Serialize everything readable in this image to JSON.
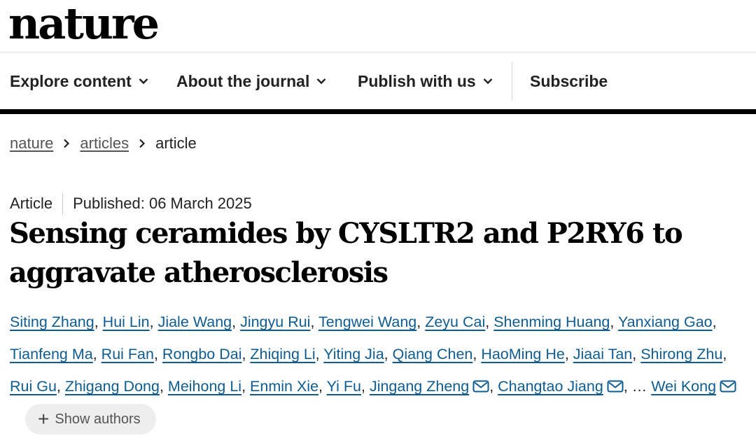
{
  "header": {
    "logo": "nature"
  },
  "nav": {
    "items": [
      {
        "label": "Explore content"
      },
      {
        "label": "About the journal"
      },
      {
        "label": "Publish with us"
      }
    ],
    "subscribe": "Subscribe"
  },
  "breadcrumb": {
    "items": [
      "nature",
      "articles",
      "article"
    ]
  },
  "article": {
    "type": "Article",
    "published": "Published: 06 March 2025",
    "title": "Sensing ceramides by CYSLTR2 and P2RY6 to aggravate atherosclerosis"
  },
  "authors": {
    "list": [
      "Siting Zhang",
      "Hui Lin",
      "Jiale Wang",
      "Jingyu Rui",
      "Tengwei Wang",
      "Zeyu Cai",
      "Shenming Huang",
      "Yanxiang Gao",
      "Tianfeng Ma",
      "Rui Fan",
      "Rongbo Dai",
      "Zhiqing Li",
      "Yiting Jia",
      "Qiang Chen",
      "HaoMing He",
      "Jiaai Tan",
      "Shirong Zhu",
      "Rui Gu",
      "Zhigang Dong",
      "Meihong Li",
      "Enmin Xie",
      "Yi Fu",
      "Jingang Zheng",
      "Changtao Jiang"
    ],
    "ellipsis": "…",
    "last": "Wei Kong",
    "show_authors": "Show authors"
  },
  "icons": {
    "chevron": "chevron-down-icon",
    "mail": "mail-icon",
    "plus": "plus-icon"
  },
  "colors": {
    "link": "#0f5c91",
    "text": "#222222",
    "bar": "#000000"
  }
}
